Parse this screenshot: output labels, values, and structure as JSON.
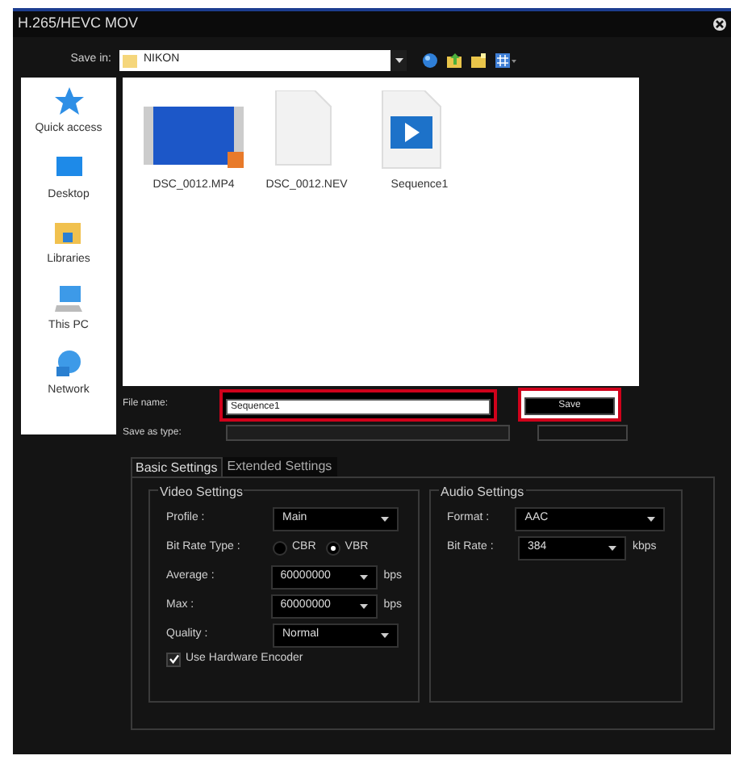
{
  "window": {
    "title": "H.265/HEVC MOV"
  },
  "save_in": {
    "label": "Save in:",
    "value": "NIKON"
  },
  "places": [
    {
      "label": "Quick access",
      "kind": "star"
    },
    {
      "label": "Desktop",
      "kind": "desktop"
    },
    {
      "label": "Libraries",
      "kind": "libraries"
    },
    {
      "label": "This PC",
      "kind": "pc"
    },
    {
      "label": "Network",
      "kind": "network"
    }
  ],
  "files": [
    {
      "name": "DSC_0012.MP4",
      "kind": "video"
    },
    {
      "name": "DSC_0012.NEV",
      "kind": "blank"
    },
    {
      "name": "Sequence1",
      "kind": "sequence"
    }
  ],
  "file_name": {
    "label": "File name:",
    "value": "Sequence1",
    "highlighted": true
  },
  "save_as_type": {
    "label": "Save as type:"
  },
  "save_button": {
    "label": "Save",
    "highlighted": true
  },
  "tabs": [
    {
      "label": "Basic Settings",
      "selected": true
    },
    {
      "label": "Extended Settings",
      "selected": false
    }
  ],
  "video_settings": {
    "title": "Video Settings",
    "rows": [
      {
        "kind": "dropdown",
        "label": "Profile :",
        "value": "Main"
      },
      {
        "kind": "radio",
        "label": "Bit Rate Type :",
        "options": [
          {
            "label": "CBR",
            "selected": false
          },
          {
            "label": "VBR",
            "selected": true
          }
        ]
      },
      {
        "kind": "dropdown",
        "label": "Average :",
        "value": "60000000",
        "unit": "bps"
      },
      {
        "kind": "dropdown",
        "label": "Max :",
        "value": "60000000",
        "unit": "bps"
      },
      {
        "kind": "dropdown",
        "label": "Quality :",
        "value": "Normal"
      },
      {
        "kind": "checkbox",
        "label": "Use Hardware Encoder",
        "checked": true
      }
    ]
  },
  "audio_settings": {
    "title": "Audio Settings",
    "rows": [
      {
        "kind": "dropdown",
        "label": "Format :",
        "value": "AAC",
        "wide": true
      },
      {
        "kind": "dropdown",
        "label": "Bit Rate :",
        "value": "384",
        "unit": "kbps"
      }
    ]
  }
}
